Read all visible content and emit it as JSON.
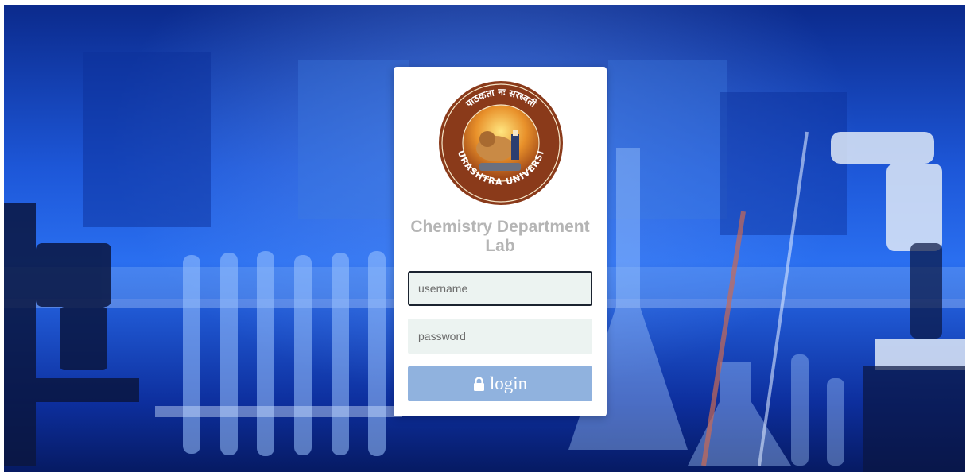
{
  "login_card": {
    "logo": {
      "top_text": "पाठकता नः सरस्वती",
      "bottom_text": "SAURASHTRA UNIVERSITY"
    },
    "title": "Chemistry Department Lab",
    "username": {
      "placeholder": "username",
      "value": ""
    },
    "password": {
      "placeholder": "password",
      "value": ""
    },
    "login_button": {
      "label": "login",
      "icon": "lock-icon"
    }
  },
  "colors": {
    "button_bg": "#90b2de",
    "field_bg": "#ecf3f1",
    "title_color": "#b5b5b5",
    "logo_ring": "#8a3a1a"
  }
}
